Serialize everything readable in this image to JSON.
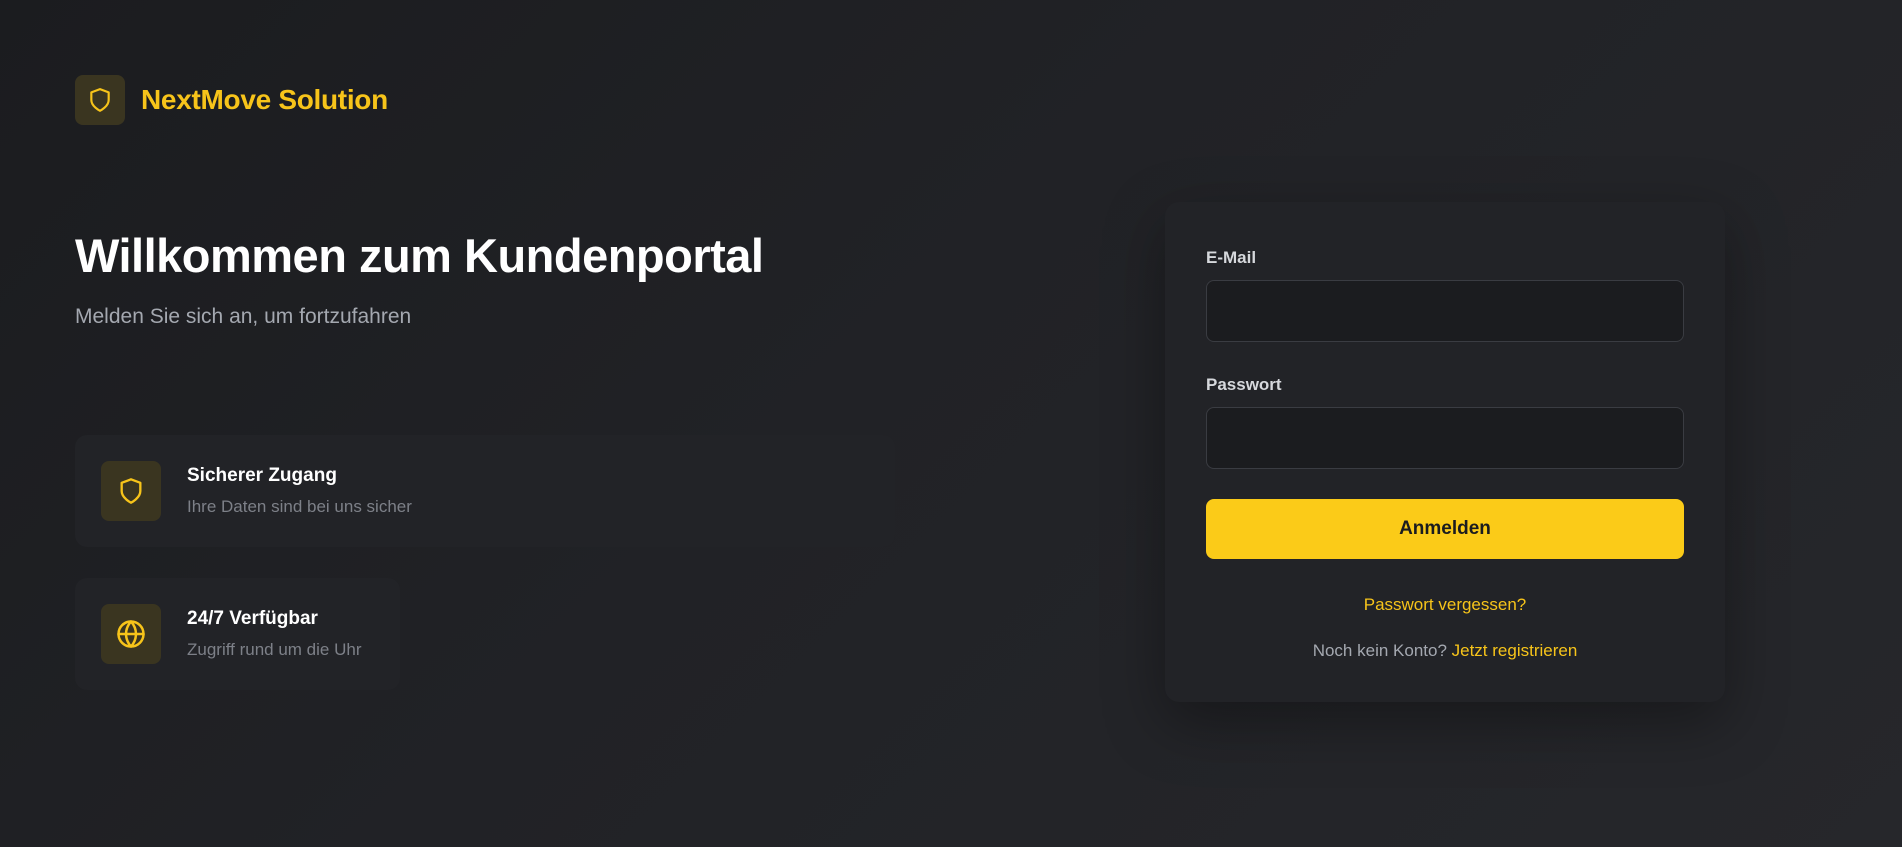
{
  "brand": {
    "name": "NextMove Solution",
    "icon": "shield-icon",
    "accent_color": "#f7c41a"
  },
  "hero": {
    "title": "Willkommen zum Kundenportal",
    "subtitle": "Melden Sie sich an, um fortzufahren"
  },
  "features": [
    {
      "icon": "shield-icon",
      "title": "Sicherer Zugang",
      "description": "Ihre Daten sind bei uns sicher"
    },
    {
      "icon": "globe-icon",
      "title": "24/7 Verfügbar",
      "description": "Zugriff rund um die Uhr"
    }
  ],
  "login": {
    "email_label": "E-Mail",
    "email_value": "",
    "password_label": "Passwort",
    "password_value": "",
    "submit_label": "Anmelden",
    "forgot_label": "Passwort vergessen?",
    "register_prompt": "Noch kein Konto?",
    "register_label": "Jetzt registrieren",
    "button_color": "#fbcb18"
  }
}
